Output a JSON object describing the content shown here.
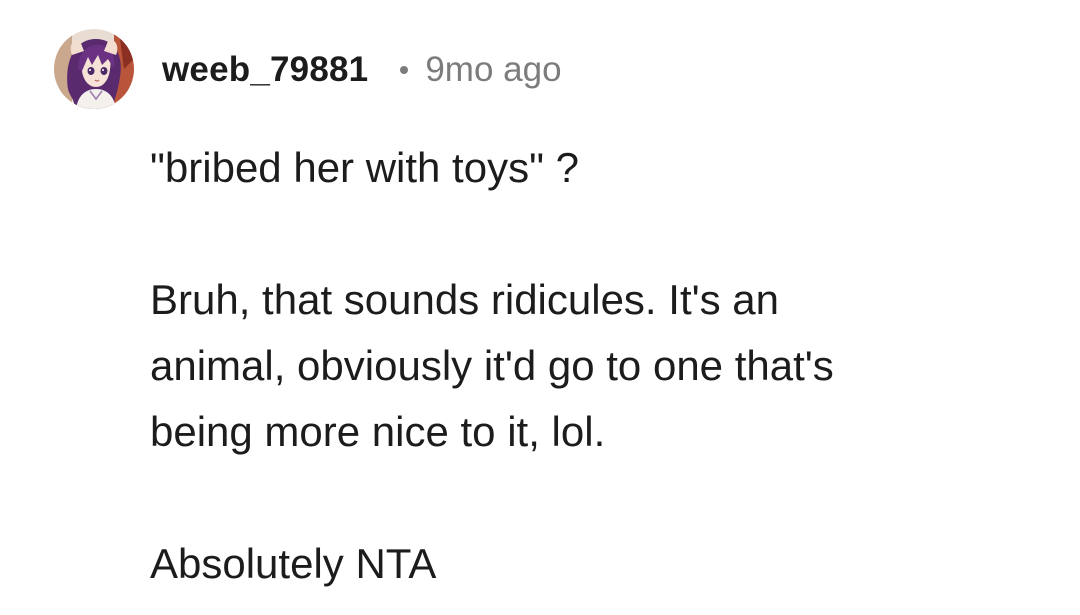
{
  "comment": {
    "avatar_icon": "anime-avatar-icon",
    "username": "weeb_79881",
    "separator": "•",
    "timestamp": "9mo ago",
    "paragraphs": [
      {
        "lines": [
          "\"bribed her with toys\" ?"
        ]
      },
      {
        "lines": [
          "Bruh, that sounds ridicules. It's an",
          "animal, obviously it'd go to one that's",
          "being more nice to it, lol."
        ]
      },
      {
        "lines": [
          "Absolutely NTA"
        ]
      }
    ]
  },
  "colors": {
    "text": "#1c1c1c",
    "muted": "#7c7c7c",
    "background": "#ffffff"
  }
}
